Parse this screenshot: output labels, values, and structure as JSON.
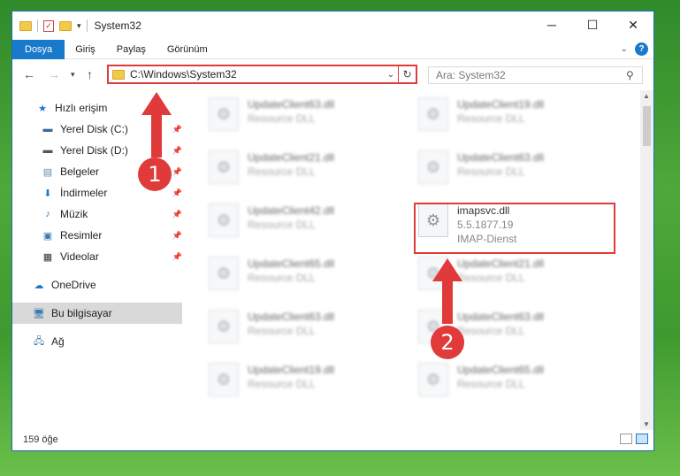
{
  "title": "System32",
  "window_controls": {
    "minimize": "─",
    "maximize": "☐",
    "close": "✕"
  },
  "ribbon": {
    "tabs": [
      "Dosya",
      "Giriş",
      "Paylaş",
      "Görünüm"
    ]
  },
  "address": {
    "path": "C:\\Windows\\System32"
  },
  "search": {
    "placeholder": "Ara: System32"
  },
  "sidebar": {
    "quick_access": "Hızlı erişim",
    "items": [
      {
        "label": "Yerel Disk (C:)",
        "icon": "drive-icon"
      },
      {
        "label": "Yerel Disk (D:)",
        "icon": "drive-icon"
      },
      {
        "label": "Belgeler",
        "icon": "documents-icon"
      },
      {
        "label": "İndirmeler",
        "icon": "downloads-icon"
      },
      {
        "label": "Müzik",
        "icon": "music-icon"
      },
      {
        "label": "Resimler",
        "icon": "pictures-icon"
      },
      {
        "label": "Videolar",
        "icon": "videos-icon"
      }
    ],
    "onedrive": "OneDrive",
    "this_pc": "Bu bilgisayar",
    "network": "Ağ"
  },
  "files": {
    "left": [
      {
        "name": "UpdateClient63.dll",
        "type": "Resource DLL"
      },
      {
        "name": "UpdateClient21.dll",
        "type": "Resource DLL"
      },
      {
        "name": "UpdateClient42.dll",
        "type": "Resource DLL"
      },
      {
        "name": "UpdateClient65.dll",
        "type": "Resource DLL"
      },
      {
        "name": "UpdateClient63.dll",
        "type": "Resource DLL"
      },
      {
        "name": "UpdateClient19.dll",
        "type": "Resource DLL"
      }
    ],
    "right": [
      {
        "name": "UpdateClient19.dll",
        "type": "Resource DLL"
      },
      {
        "name": "UpdateClient63.dll",
        "type": "Resource DLL"
      },
      {
        "name": "imapsvc.dll",
        "version": "5.5.1877.19",
        "type": "IMAP-Dienst"
      },
      {
        "name": "UpdateClient21.dll",
        "type": "Resource DLL"
      },
      {
        "name": "UpdateClient63.dll",
        "type": "Resource DLL"
      },
      {
        "name": "UpdateClient65.dll",
        "type": "Resource DLL"
      }
    ]
  },
  "status": {
    "count": "159 öğe"
  },
  "badges": {
    "one": "1",
    "two": "2"
  },
  "colors": {
    "accent": "#1979ca",
    "highlight": "#e03a3a"
  }
}
